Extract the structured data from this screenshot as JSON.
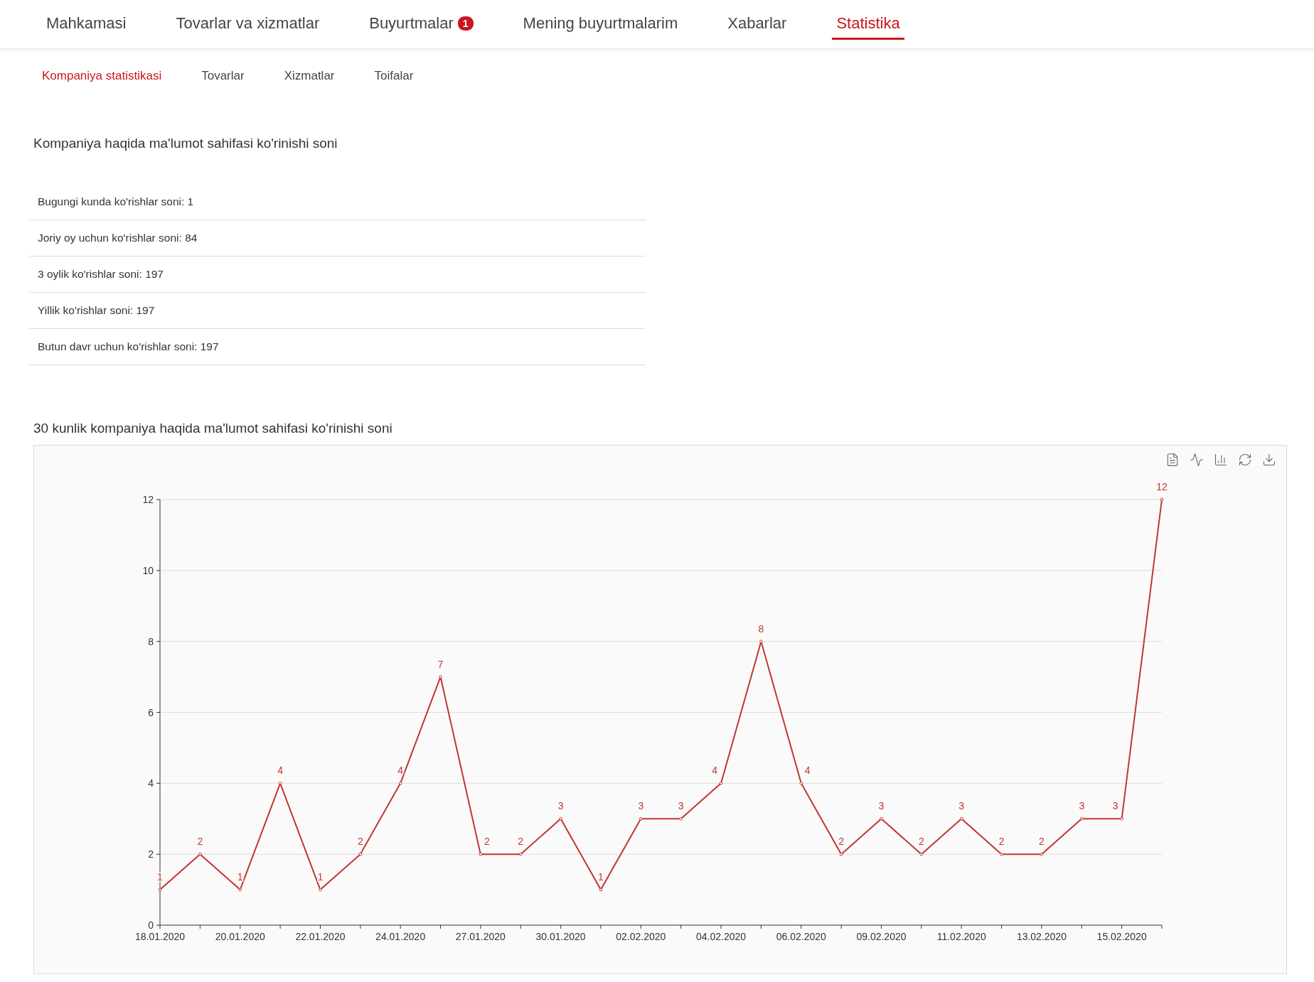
{
  "nav": {
    "items": [
      {
        "label": "Mahkamasi",
        "selected": false
      },
      {
        "label": "Tovarlar va xizmatlar",
        "selected": false
      },
      {
        "label": "Buyurtmalar",
        "selected": false,
        "badge": "1"
      },
      {
        "label": "Mening buyurtmalarim",
        "selected": false
      },
      {
        "label": "Xabarlar",
        "selected": false
      },
      {
        "label": "Statistika",
        "selected": true
      }
    ]
  },
  "subnav": {
    "items": [
      {
        "label": "Kompaniya statistikasi",
        "selected": true
      },
      {
        "label": "Tovarlar",
        "selected": false
      },
      {
        "label": "Xizmatlar",
        "selected": false
      },
      {
        "label": "Toifalar",
        "selected": false
      }
    ]
  },
  "views": {
    "title": "Kompaniya haqida ma'lumot sahifasi ko'rinishi soni",
    "rows": [
      "Bugungi kunda ko'rishlar soni: 1",
      "Joriy oy uchun ko'rishlar soni: 84",
      "3 oylik ko'rishlar soni: 197",
      "Yillik ko'rishlar soni: 197",
      "Butun davr uchun ko'rishlar soni: 197"
    ]
  },
  "chart_section": {
    "title": "30 kunlik kompaniya haqida ma'lumot sahifasi ko'rinishi soni",
    "chart_data": {
      "type": "line",
      "categories": [
        "18.01.2020",
        null,
        "20.01.2020",
        null,
        "22.01.2020",
        null,
        "24.01.2020",
        null,
        "27.01.2020",
        null,
        "30.01.2020",
        null,
        "02.02.2020",
        null,
        "04.02.2020",
        null,
        "06.02.2020",
        null,
        "09.02.2020",
        null,
        "11.02.2020",
        null,
        "13.02.2020",
        null,
        "15.02.2020",
        null
      ],
      "series": [
        {
          "color": "#c23531",
          "marker": "circle",
          "values": [
            1,
            2,
            1,
            4,
            1,
            2,
            4,
            7,
            2,
            2,
            3,
            1,
            3,
            3,
            4,
            8,
            4,
            2,
            3,
            2,
            3,
            2,
            2,
            3,
            3,
            12
          ]
        }
      ],
      "grid": true,
      "ylim": [
        0,
        12
      ],
      "yticks": [
        0,
        2,
        4,
        6,
        8,
        10,
        12
      ],
      "data_labels": true
    }
  }
}
